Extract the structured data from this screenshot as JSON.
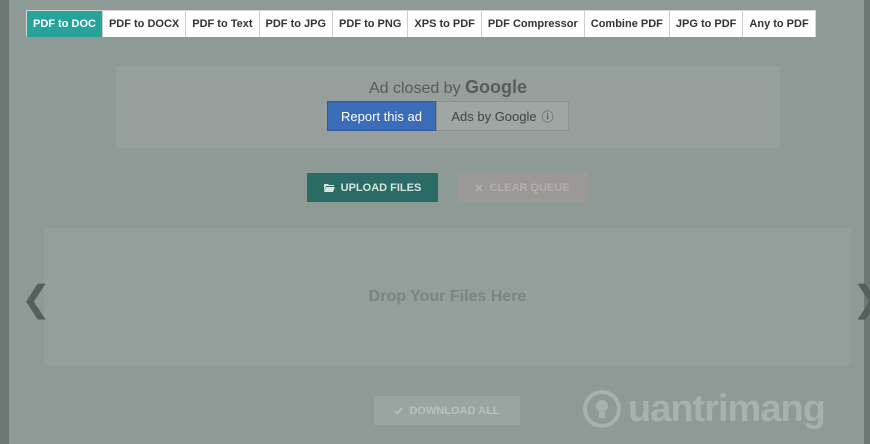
{
  "tabs": [
    {
      "label": "PDF to DOC",
      "active": true
    },
    {
      "label": "PDF to DOCX"
    },
    {
      "label": "PDF to Text"
    },
    {
      "label": "PDF to JPG"
    },
    {
      "label": "PDF to PNG"
    },
    {
      "label": "XPS to PDF"
    },
    {
      "label": "PDF Compressor"
    },
    {
      "label": "Combine PDF"
    },
    {
      "label": "JPG to PDF"
    },
    {
      "label": "Any to PDF"
    }
  ],
  "ad": {
    "closed_prefix": "Ad closed by",
    "brand": "Google",
    "report_label": "Report this ad",
    "adsby_label": "Ads by Google",
    "info_glyph": "ⓘ"
  },
  "actions": {
    "upload_label": "UPLOAD FILES",
    "upload_icon": "folder-open-icon",
    "clear_label": "CLEAR QUEUE",
    "clear_icon": "close-icon",
    "download_label": "DOWNLOAD ALL",
    "download_icon": "check-icon"
  },
  "dropzone": {
    "text": "Drop Your Files Here",
    "prev_glyph": "❮",
    "next_glyph": "❯"
  },
  "watermark": {
    "text": "uantrimang"
  },
  "colors": {
    "tab_active": "#27a39a",
    "upload_bg": "#2a6b63",
    "report_bg": "#3a6cb8",
    "overlay_bg": "#8e9a96"
  }
}
